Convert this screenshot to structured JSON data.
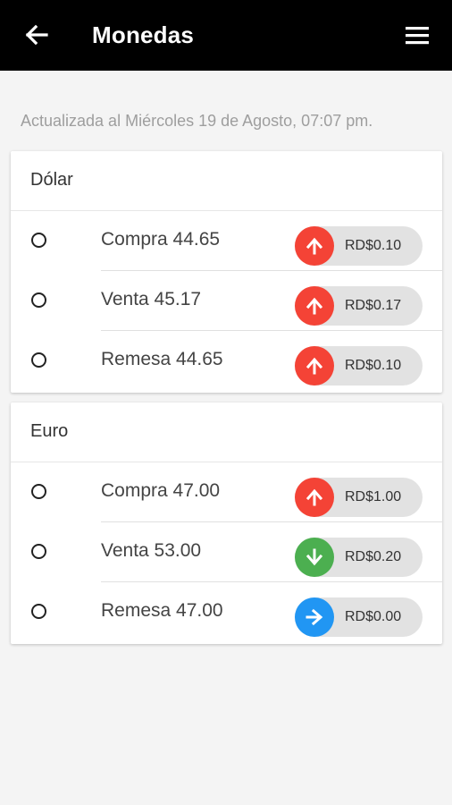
{
  "appbar": {
    "title": "Monedas",
    "back_icon": "arrow-left-icon",
    "menu_icon": "hamburger-menu-icon"
  },
  "updated_text": "Actualizada al Miércoles 19 de Agosto, 07:07 pm.",
  "colors": {
    "up": "#f44336",
    "down": "#4caf50",
    "neutral": "#2196f3",
    "appbar": "#000000"
  },
  "currencies": [
    {
      "name": "Dólar",
      "rows": [
        {
          "label": "Compra 44.65",
          "change": "RD$0.10",
          "trend": "up",
          "icon": "arrow-up-icon"
        },
        {
          "label": "Venta 45.17",
          "change": "RD$0.17",
          "trend": "up",
          "icon": "arrow-up-icon"
        },
        {
          "label": "Remesa 44.65",
          "change": "RD$0.10",
          "trend": "up",
          "icon": "arrow-up-icon"
        }
      ]
    },
    {
      "name": "Euro",
      "rows": [
        {
          "label": "Compra 47.00",
          "change": "RD$1.00",
          "trend": "up",
          "icon": "arrow-up-icon"
        },
        {
          "label": "Venta 53.00",
          "change": "RD$0.20",
          "trend": "down",
          "icon": "arrow-down-icon"
        },
        {
          "label": "Remesa 47.00",
          "change": "RD$0.00",
          "trend": "neutral",
          "icon": "arrow-right-icon"
        }
      ]
    }
  ]
}
